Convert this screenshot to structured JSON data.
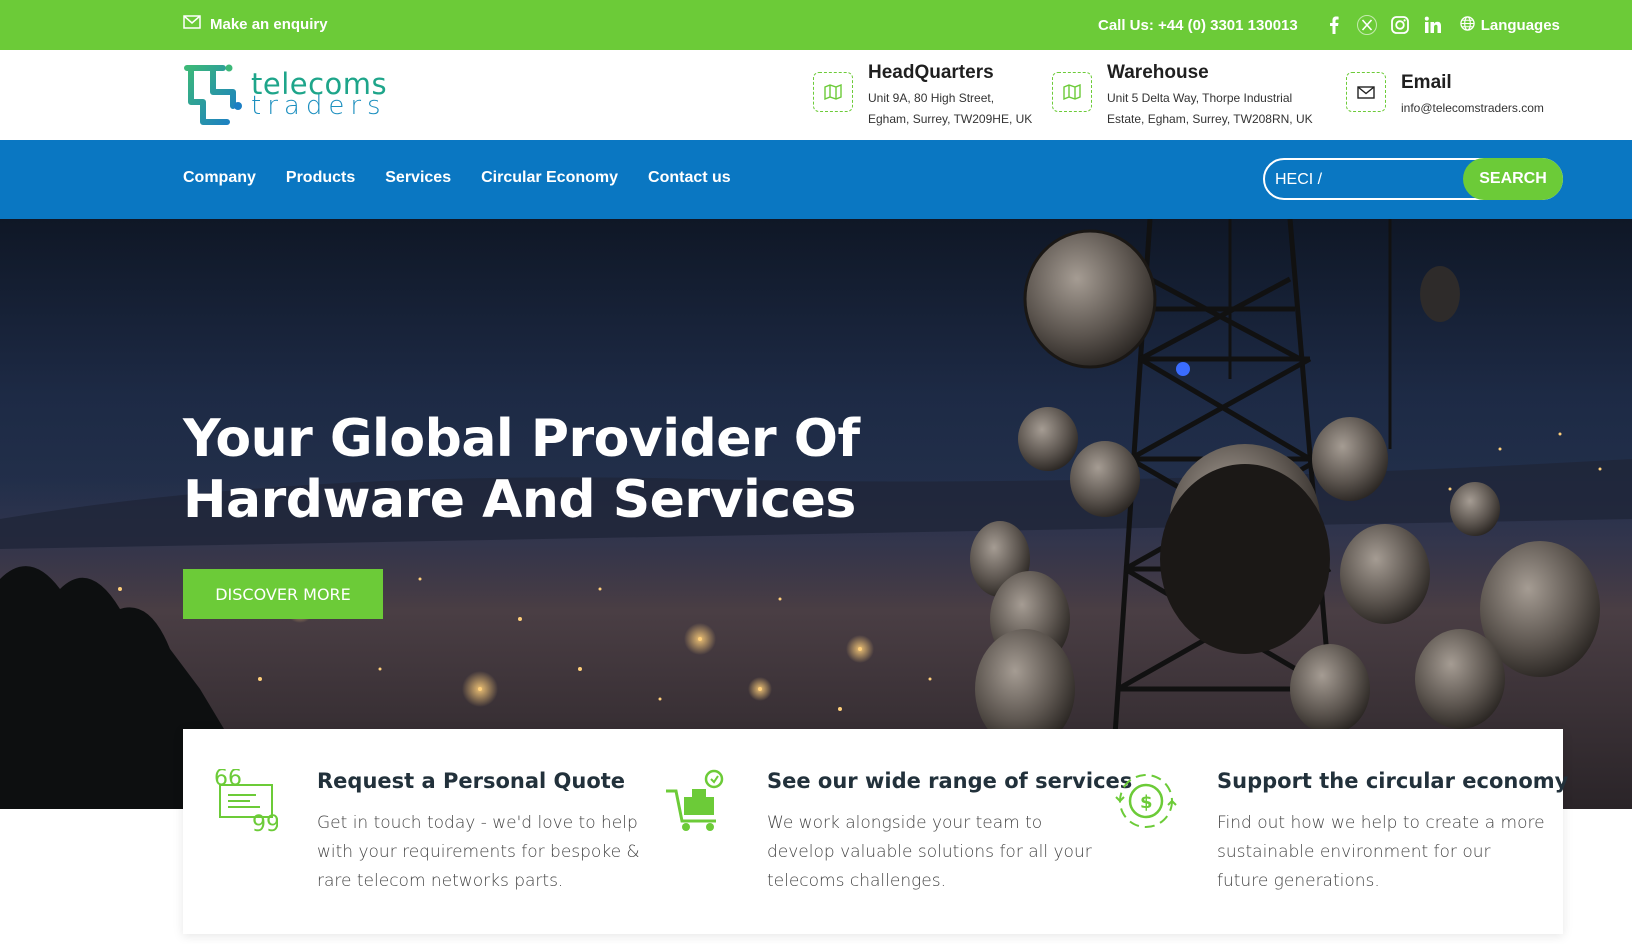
{
  "topbar": {
    "enquiry": "Make an enquiry",
    "phone": "Call Us: +44 (0) 3301 130013",
    "languages": "Languages",
    "icons": [
      "mail-icon",
      "facebook-icon",
      "x-icon",
      "instagram-icon",
      "linkedin-icon",
      "globe-icon"
    ]
  },
  "logo": {
    "line1": "telecoms",
    "line2": "traders"
  },
  "header": {
    "hq": {
      "title": "HeadQuarters",
      "line1": "Unit 9A, 80 High Street,",
      "line2": "Egham, Surrey, TW209HE, UK"
    },
    "warehouse": {
      "title": "Warehouse",
      "line1": "Unit 5 Delta Way, Thorpe Industrial",
      "line2": "Estate, Egham, Surrey, TW208RN, UK"
    },
    "email": {
      "title": "Email",
      "value": "info@telecomstraders.com"
    }
  },
  "nav": {
    "items": [
      "Company",
      "Products",
      "Services",
      "Circular Economy",
      "Contact us"
    ],
    "search_value": "HECI /",
    "search_button": "SEARCH"
  },
  "hero": {
    "title_line1": "Your Global Provider Of",
    "title_line2": "Hardware And Services",
    "button": "DISCOVER MORE"
  },
  "cards": [
    {
      "title": "Request a Personal Quote",
      "text": "Get in touch today - we'd love to help with your requirements for bespoke & rare telecom networks parts.",
      "icon": "quote-icon"
    },
    {
      "title": "See our wide range of services",
      "text": "We work alongside your team to develop valuable solutions for all your telecoms challenges.",
      "icon": "cart-icon"
    },
    {
      "title": "Support the circular economy",
      "text": "Find out how we help to create a more sustainable environment for our future generations.",
      "icon": "circular-economy-icon"
    }
  ],
  "colors": {
    "green": "#6ccb38",
    "blue": "#0a77c2",
    "dark_text": "#22313b"
  }
}
